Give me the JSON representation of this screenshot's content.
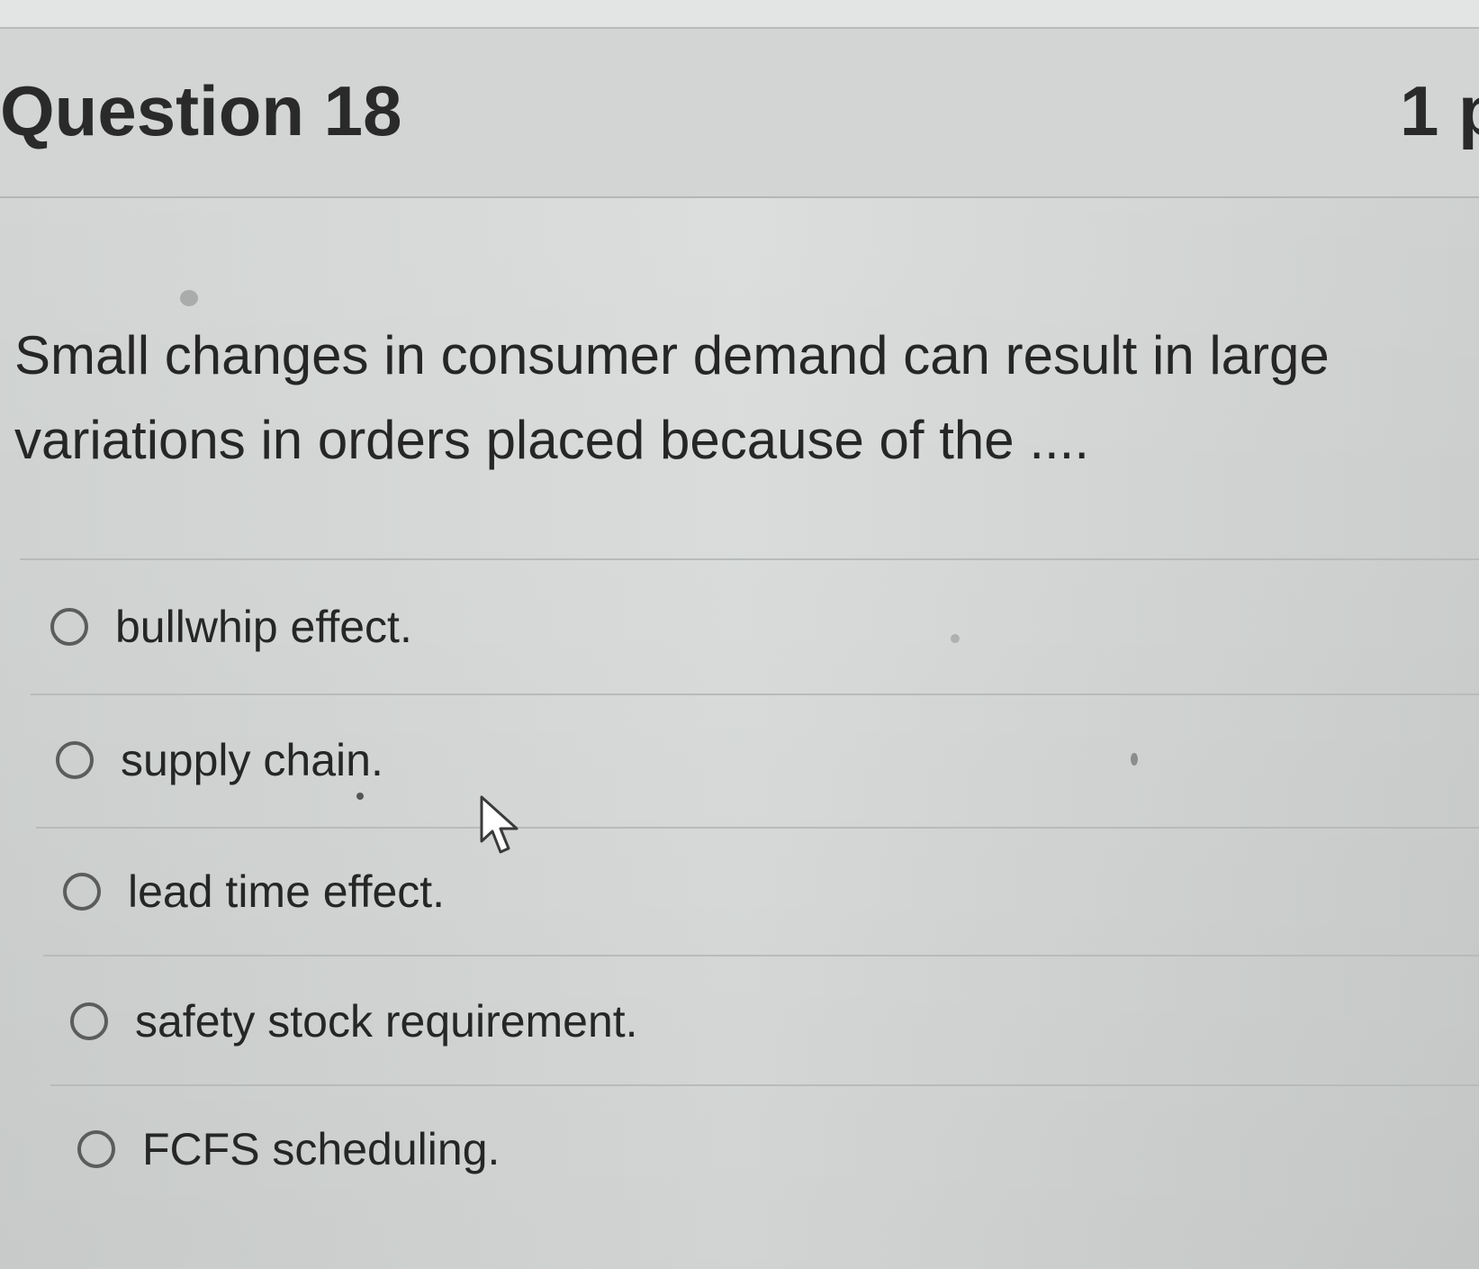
{
  "question": {
    "title": "Question 18",
    "points": "1 p",
    "text_lines": [
      "Small changes in consumer demand can result in large",
      "variations in orders placed because of the ...."
    ]
  },
  "answers": [
    {
      "label": "bullwhip effect."
    },
    {
      "label": "supply chain."
    },
    {
      "label": "lead time effect."
    },
    {
      "label": "safety stock requirement."
    },
    {
      "label": "FCFS scheduling."
    }
  ],
  "icons": {
    "radio": "radio-button-unselected-icon",
    "cursor": "mouse-pointer-arrow-icon"
  },
  "colors": {
    "background": "#d6d9d8",
    "text": "#262626",
    "divider": "#b8bbba",
    "radio_border": "#5b5d5c"
  }
}
